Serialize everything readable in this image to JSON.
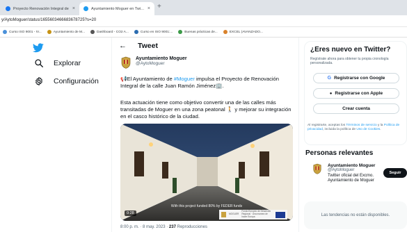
{
  "browser": {
    "tabs": [
      {
        "title": "Proyecto Renovación Integral de",
        "close": "×"
      },
      {
        "title": "Ayuntamiento Moguer en Twitter:",
        "close": "×"
      }
    ],
    "new_tab": "+",
    "url": "y/AytoMoguer/status/1655603466683678725?s=20",
    "bookmarks": [
      "Curso ISO 9001 - IV...",
      "Ayuntamiento de M...",
      "Dashboard - CO2 A...",
      "Curso en ISO 9001:...",
      "Buenas prácticas de...",
      "EXCEL (AVANZADO..."
    ]
  },
  "nav": {
    "items": [
      {
        "label": "Explorar",
        "icon": "hashtag-icon"
      },
      {
        "label": "Configuración",
        "icon": "gear-icon"
      }
    ]
  },
  "tweet": {
    "header_title": "Tweet",
    "author_name": "Ayuntamiento Moguer",
    "author_handle": "@AytoMoguer",
    "line1_a": "📢El Ayuntamiento de ",
    "line1_link": "#Moguer",
    "line1_b": " impulsa el Proyecto de Renovación Integral de la calle Juan Ramón Jiménez🏢.",
    "line2": "Esta actuación tiene como objetivo convertir una de las calles más transitadas de Moguer en una zona peatonal 🚶 y mejorar su integración en el casco histórico de la ciudad.",
    "video_caption": "With this project funded 80% by FEDER funds",
    "video_duration": "0:28",
    "strip_text_a": "MOGUER",
    "strip_text_b": "Fondo Europeo de Desarrollo Regional · Una manera de hacer Europa",
    "time": "8:00 p. m. · 8 may. 2023 · ",
    "views_count": "237",
    "views_label": " Reproducciones"
  },
  "signup": {
    "title": "¿Eres nuevo en Twitter?",
    "subtitle": "Regístrate ahora para obtener tu propia cronología personalizada.",
    "google": "Registrarse con Google",
    "apple": "Registrarse con Apple",
    "create": "Crear cuenta",
    "legal_a": "Al registrarte, aceptas los ",
    "legal_terms": "Términos de servicio",
    "legal_b": " y la ",
    "legal_privacy": "Política de privacidad",
    "legal_c": ", incluida la política de ",
    "legal_cookies": "Uso de Cookies",
    "legal_d": "."
  },
  "relevant": {
    "title": "Personas relevantes",
    "name": "Ayuntamiento Moguer",
    "handle": "@AytoMoguer",
    "bio": "Twitter oficial del Excmo. Ayuntamiento de Moguer",
    "follow": "Seguir"
  },
  "trends": {
    "message": "Las tendencias no están disponibles."
  },
  "colors": {
    "accent": "#1d9bf0",
    "text": "#0f1419",
    "muted": "#536471"
  }
}
